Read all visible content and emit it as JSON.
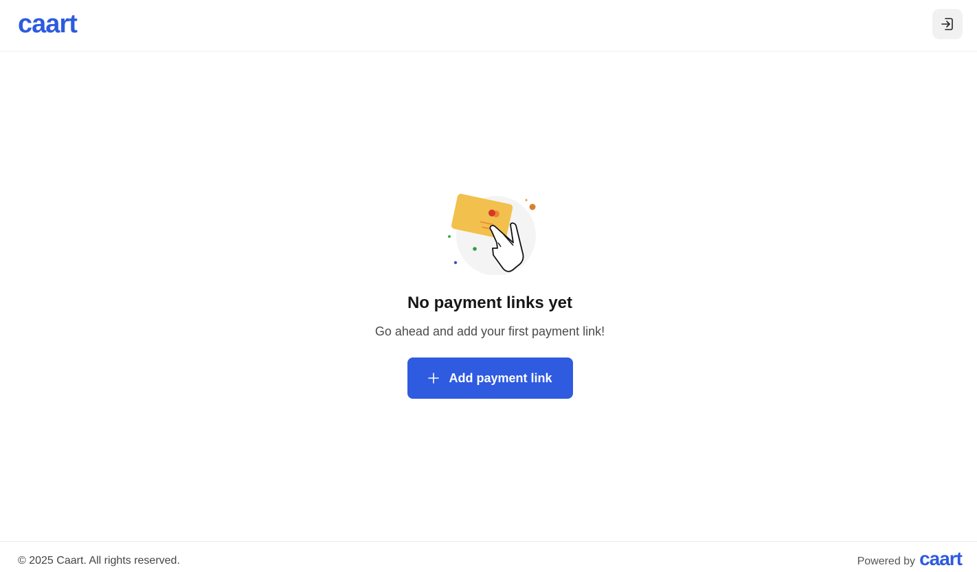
{
  "header": {
    "logo_text": "caart",
    "login_icon": "login-icon"
  },
  "empty_state": {
    "illustration": "card-in-hand-illustration",
    "title": "No payment links yet",
    "subtitle": "Go ahead and add your first payment link!",
    "button_label": "Add payment link",
    "button_icon": "plus-icon"
  },
  "footer": {
    "copyright": "© 2025 Caart. All rights reserved.",
    "powered_label": "Powered by",
    "powered_logo": "caart"
  },
  "colors": {
    "brand": "#2d5bdf",
    "button": "#2f5be0",
    "card": "#f2c04c"
  }
}
